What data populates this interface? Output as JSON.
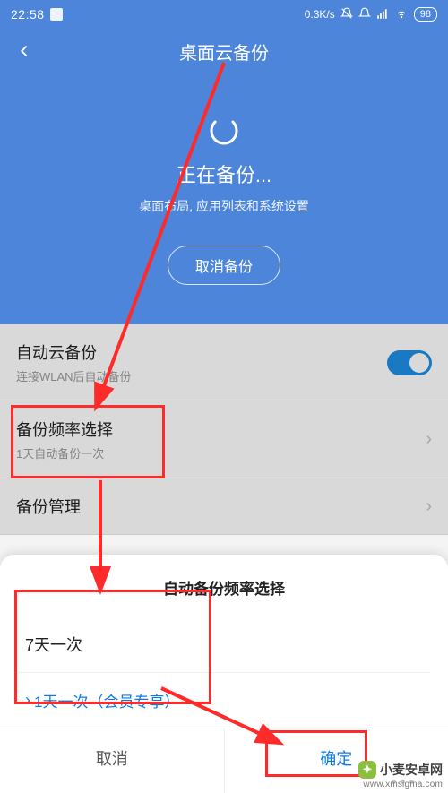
{
  "status": {
    "time": "22:58",
    "net_rate": "0.3K/s",
    "battery": "98"
  },
  "header": {
    "title": "桌面云备份",
    "status_text": "正在备份...",
    "sub_text": "桌面布局, 应用列表和系统设置",
    "cancel_label": "取消备份"
  },
  "rows": {
    "auto": {
      "title": "自动云备份",
      "sub": "连接WLAN后自动备份"
    },
    "freq": {
      "title": "备份频率选择",
      "sub": "1天自动备份一次"
    },
    "manage": {
      "title": "备份管理"
    }
  },
  "sheet": {
    "title": "自动备份频率选择",
    "option1": "7天一次",
    "option2": "1天一次（会员专享）",
    "cancel": "取消",
    "confirm": "确定"
  },
  "watermark": {
    "name": "小麦安卓网",
    "url": "www.xmsigma.com"
  },
  "icons": {
    "back": "back-chevron-icon",
    "spinner": "spinner-icon",
    "mute": "mute-bell-icon",
    "bell": "bell-icon",
    "signal": "signal-icon",
    "wifi": "wifi-icon",
    "battery": "battery-icon",
    "chevron": "chevron-right-icon",
    "caret": "caret-right-icon"
  }
}
